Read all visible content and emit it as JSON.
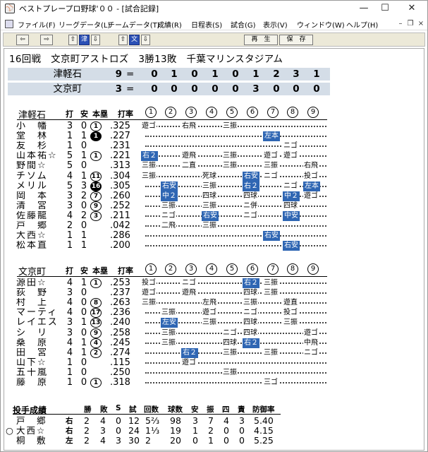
{
  "window": {
    "title": "ベストプレープロ野球'００ - [試合記録]"
  },
  "menu": [
    "ファイル(F)",
    "リーグデータ(L)",
    "チームデータ(T)",
    "成績(R)",
    "日程表(S)",
    "試合(G)",
    "表示(V)",
    "ウィンドウ(W)",
    "ヘルプ(H)"
  ],
  "toolbar": {
    "prev": "⇦",
    "next": "⇨",
    "up1": "⇧",
    "team1": "津",
    "down1": "⇩",
    "up2": "⇧",
    "team2": "文",
    "down2": "⇩",
    "replay": "再　生",
    "save": "保　存"
  },
  "header": "16回戦　文京町アストロズ　3勝13敗　千葉マリンスタジアム",
  "line_score": [
    {
      "team": "津軽石",
      "runs": "9",
      "eq": "=",
      "innings": [
        "0",
        "1",
        "0",
        "1",
        "0",
        "1",
        "2",
        "3",
        "1"
      ]
    },
    {
      "team": "文京町",
      "runs": "3",
      "eq": "=",
      "innings": [
        "0",
        "0",
        "0",
        "0",
        "0",
        "3",
        "0",
        "0",
        "0"
      ]
    }
  ],
  "batting_headers": {
    "ab": "打",
    "h": "安",
    "hr": "本塁",
    "avg": "打率",
    "inn": [
      "1",
      "2",
      "3",
      "4",
      "5",
      "6",
      "7",
      "8",
      "9"
    ]
  },
  "home": {
    "team": "津軽石",
    "players": [
      {
        "name": "小　幡",
        "ab": "3",
        "h": "0",
        "hr": "1",
        "hrf": false,
        "avg": ".325",
        "res": [
          [
            "遊ゴ",
            0,
            0
          ],
          [
            "右飛",
            2,
            0
          ],
          [
            "三振",
            4,
            0
          ]
        ]
      },
      {
        "name": "堂　林",
        "ab": "1",
        "h": "1",
        "hr": "1",
        "hrf": true,
        "avg": ".227",
        "res": [
          [
            "左本",
            6,
            1
          ]
        ]
      },
      {
        "name": "友　杉",
        "ab": "1",
        "h": "0",
        "hr": "",
        "hrf": false,
        "avg": ".231",
        "res": [
          [
            "ニゴ",
            7,
            0
          ]
        ]
      },
      {
        "name": "山本祐☆",
        "ab": "5",
        "h": "1",
        "hr": "1",
        "hrf": false,
        "avg": ".221",
        "res": [
          [
            "右２",
            0,
            1
          ],
          [
            "遊飛",
            2,
            0
          ],
          [
            "三振",
            4,
            0
          ],
          [
            "遊ゴ",
            6,
            0
          ],
          [
            "遊ゴ",
            7,
            0
          ]
        ]
      },
      {
        "name": "野間☆",
        "ab": "5",
        "h": "0",
        "hr": "",
        "hrf": false,
        "avg": ".313",
        "res": [
          [
            "三振",
            0,
            0
          ],
          [
            "二直",
            2,
            0
          ],
          [
            "三振",
            4,
            0
          ],
          [
            "三振",
            6,
            0
          ],
          [
            "右飛",
            8,
            0
          ]
        ]
      },
      {
        "name": "チソム",
        "ab": "4",
        "h": "1",
        "hr": "11",
        "hrf": false,
        "avg": ".304",
        "res": [
          [
            "三振",
            0,
            0
          ],
          [
            "死球",
            3,
            0
          ],
          [
            "右安",
            5,
            1
          ],
          [
            "ニゴ",
            6,
            0
          ],
          [
            "投ゴ",
            8,
            0
          ]
        ]
      },
      {
        "name": "メリル",
        "ab": "5",
        "h": "3",
        "hr": "16",
        "hrf": true,
        "avg": ".305",
        "res": [
          [
            "右安",
            1,
            1
          ],
          [
            "三振",
            3,
            0
          ],
          [
            "右２",
            5,
            1
          ],
          [
            "ニゴ",
            7,
            0
          ],
          [
            "左本",
            8,
            1
          ]
        ]
      },
      {
        "name": "岡　本",
        "ab": "3",
        "h": "2",
        "hr": "7",
        "hrf": false,
        "avg": ".260",
        "res": [
          [
            "中２",
            1,
            1
          ],
          [
            "四球",
            3,
            0
          ],
          [
            "四球",
            5,
            0
          ],
          [
            "中２",
            7,
            1
          ],
          [
            "遊ゴ",
            8,
            0
          ]
        ]
      },
      {
        "name": "清　宮",
        "ab": "3",
        "h": "0",
        "hr": "9",
        "hrf": false,
        "avg": ".252",
        "res": [
          [
            "三振",
            1,
            0
          ],
          [
            "三振",
            3,
            0
          ],
          [
            "ニ併",
            5,
            0
          ],
          [
            "四球",
            7,
            0
          ]
        ]
      },
      {
        "name": "佐藤龍",
        "ab": "4",
        "h": "2",
        "hr": "3",
        "hrf": false,
        "avg": ".211",
        "res": [
          [
            "ニゴ",
            1,
            0
          ],
          [
            "右安",
            3,
            1
          ],
          [
            "ニゴ",
            5,
            0
          ],
          [
            "中安",
            7,
            1
          ]
        ]
      },
      {
        "name": "戸　郷",
        "ab": "2",
        "h": "0",
        "hr": "",
        "hrf": false,
        "avg": ".042",
        "res": [
          [
            "二飛",
            1,
            0
          ],
          [
            "三振",
            3,
            0
          ]
        ]
      },
      {
        "name": "大西☆",
        "ab": "1",
        "h": "1",
        "hr": "",
        "hrf": false,
        "avg": ".286",
        "res": [
          [
            "右安",
            6,
            1
          ]
        ]
      },
      {
        "name": "松本直",
        "ab": "1",
        "h": "1",
        "hr": "",
        "hrf": false,
        "avg": ".200",
        "res": [
          [
            "右安",
            7,
            1
          ]
        ]
      }
    ]
  },
  "away": {
    "team": "文京町",
    "players": [
      {
        "name": "源田☆",
        "ab": "4",
        "h": "1",
        "hr": "1",
        "hrf": false,
        "avg": ".253",
        "res": [
          [
            "投ゴ",
            0,
            0
          ],
          [
            "ニゴ",
            2,
            0
          ],
          [
            "右２",
            5,
            1
          ],
          [
            "三振",
            6,
            0
          ]
        ]
      },
      {
        "name": "荻　野",
        "ab": "3",
        "h": "0",
        "hr": "",
        "hrf": false,
        "avg": ".237",
        "res": [
          [
            "遊ゴ",
            0,
            0
          ],
          [
            "遊飛",
            2,
            0
          ],
          [
            "四球",
            5,
            0
          ],
          [
            "三振",
            6,
            0
          ]
        ]
      },
      {
        "name": "村　上",
        "ab": "4",
        "h": "0",
        "hr": "8",
        "hrf": false,
        "avg": ".263",
        "res": [
          [
            "三振",
            0,
            0
          ],
          [
            "左飛",
            3,
            0
          ],
          [
            "三振",
            5,
            0
          ],
          [
            "遊直",
            7,
            0
          ]
        ]
      },
      {
        "name": "マーティ☆",
        "ab": "4",
        "h": "0",
        "hr": "17",
        "hrf": false,
        "avg": ".236",
        "res": [
          [
            "三振",
            1,
            0
          ],
          [
            "遊ゴ",
            3,
            0
          ],
          [
            "ニゴ",
            5,
            0
          ],
          [
            "投ゴ",
            7,
            0
          ]
        ]
      },
      {
        "name": "レイエス☆",
        "ab": "3",
        "h": "1",
        "hr": "13",
        "hrf": false,
        "avg": ".240",
        "res": [
          [
            "左安",
            1,
            1
          ],
          [
            "三振",
            3,
            0
          ],
          [
            "四球",
            5,
            0
          ],
          [
            "三振",
            7,
            0
          ]
        ]
      },
      {
        "name": "シ　リ",
        "ab": "3",
        "h": "0",
        "hr": "9",
        "hrf": false,
        "avg": ".258",
        "res": [
          [
            "三振",
            1,
            0
          ],
          [
            "ニゴ",
            4,
            0
          ],
          [
            "四球",
            5,
            0
          ],
          [
            "遊ゴ",
            8,
            0
          ]
        ]
      },
      {
        "name": "桑　原",
        "ab": "4",
        "h": "1",
        "hr": "4",
        "hrf": false,
        "avg": ".245",
        "res": [
          [
            "三振",
            1,
            0
          ],
          [
            "四球",
            4,
            0
          ],
          [
            "右２",
            5,
            1
          ],
          [
            "中飛",
            8,
            0
          ]
        ]
      },
      {
        "name": "田　宮",
        "ab": "4",
        "h": "1",
        "hr": "2",
        "hrf": false,
        "avg": ".274",
        "res": [
          [
            "右２",
            2,
            1
          ],
          [
            "三振",
            4,
            0
          ],
          [
            "三振",
            6,
            0
          ],
          [
            "ニゴ",
            8,
            0
          ]
        ]
      },
      {
        "name": "山下☆",
        "ab": "1",
        "h": "0",
        "hr": "",
        "hrf": false,
        "avg": ".115",
        "res": [
          [
            "遊ゴ",
            2,
            0
          ]
        ]
      },
      {
        "name": "五十嵐",
        "ab": "1",
        "h": "0",
        "hr": "",
        "hrf": false,
        "avg": ".250",
        "res": [
          [
            "三振",
            4,
            0
          ]
        ]
      },
      {
        "name": "藤　原",
        "ab": "1",
        "h": "0",
        "hr": "1",
        "hrf": false,
        "avg": ".318",
        "res": [
          [
            "三ゴ",
            6,
            0
          ]
        ]
      }
    ]
  },
  "pitching": {
    "title": "投手成績",
    "headers": [
      "勝",
      "敗",
      "S",
      "試",
      "回数",
      "球数",
      "安",
      "振",
      "四",
      "責",
      "防御率"
    ],
    "rows": [
      {
        "mark": "",
        "name": "戸　郷",
        "hand": "右",
        "w": "2",
        "l": "4",
        "s": "0",
        "g": "12",
        "ip": "5⅔",
        "np": "98",
        "h": "3",
        "so": "7",
        "bb": "4",
        "er": "3",
        "era": "5.40"
      },
      {
        "mark": "○",
        "name": "大西☆",
        "hand": "右",
        "w": "2",
        "l": "3",
        "s": "0",
        "g": "24",
        "ip": "1⅓",
        "np": "19",
        "h": "1",
        "so": "2",
        "bb": "0",
        "er": "0",
        "era": "4.15"
      },
      {
        "mark": "",
        "name": "桐　敷",
        "hand": "左",
        "w": "2",
        "l": "4",
        "s": "3",
        "g": "30",
        "ip": "2",
        "np": "20",
        "h": "0",
        "so": "1",
        "bb": "0",
        "er": "0",
        "era": "5.25"
      }
    ]
  },
  "colors": {
    "hit": "#2f66b3",
    "linescore_bg": "#d4dde7"
  }
}
